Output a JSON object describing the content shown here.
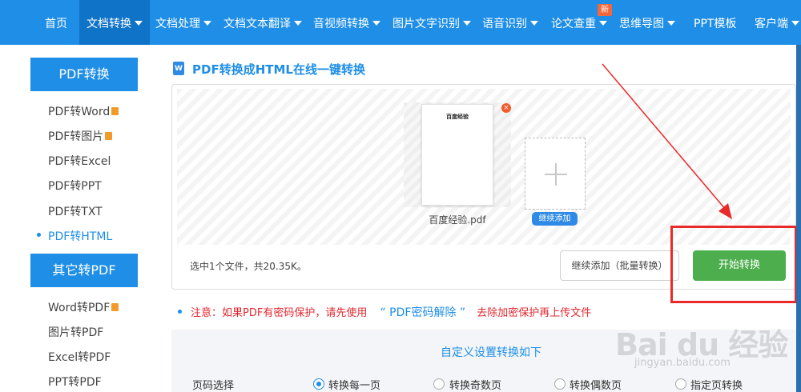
{
  "topnav": {
    "items": [
      {
        "label": "首页",
        "dropdown": false
      },
      {
        "label": "文档转换",
        "dropdown": true,
        "active": true
      },
      {
        "label": "文档处理",
        "dropdown": true
      },
      {
        "label": "文档文本翻译",
        "dropdown": true
      },
      {
        "label": "音视频转换",
        "dropdown": true
      },
      {
        "label": "图片文字识别",
        "dropdown": true
      },
      {
        "label": "语音识别",
        "dropdown": true
      },
      {
        "label": "论文查重",
        "dropdown": true
      },
      {
        "label": "思维导图",
        "dropdown": true
      },
      {
        "label": "PPT模板",
        "dropdown": false
      },
      {
        "label": "客户端",
        "dropdown": true
      }
    ],
    "new_badge": "新",
    "colors": {
      "bar": "#1e8ee6",
      "active": "#0f73c8",
      "badge": "#f5663a"
    }
  },
  "sidebar": {
    "group1_title": "PDF转换",
    "group1_items": [
      "PDF转Word",
      "PDF转图片",
      "PDF转Excel",
      "PDF转PPT",
      "PDF转TXT",
      "PDF转HTML"
    ],
    "group2_title": "其它转PDF",
    "group2_items": [
      "Word转PDF",
      "图片转PDF",
      "Excel转PDF",
      "PPT转PDF"
    ],
    "active_item": "PDF转HTML"
  },
  "main": {
    "title_icon": "W",
    "title": "PDF转换成HTML在线一键转换",
    "file": {
      "name": "百度经验.pdf",
      "preview_text": "百度经验",
      "remove_icon": "×"
    },
    "add_pill": "继续添加",
    "summary": "选中1个文件，共20.35K。",
    "btn_batch": "继续添加（批量转换）",
    "btn_start": "开始转换",
    "notice_prefix": "注意：如果PDF有密码保护，请先使用",
    "notice_link": "“ PDF密码解除 ”",
    "notice_suffix": "去除加密保护再上传文件",
    "settings_title": "自定义设置转换如下",
    "page_label": "页码选择",
    "radios": [
      {
        "label": "转换每一页",
        "checked": true
      },
      {
        "label": "转换奇数页",
        "checked": false
      },
      {
        "label": "转换偶数页",
        "checked": false
      },
      {
        "label": "指定页转换",
        "checked": false
      }
    ]
  },
  "watermark": {
    "text": "Bai du 经验",
    "sub": "jingyan.baidu.com"
  },
  "colors": {
    "primary": "#1e8ee6",
    "start_green": "#4cae4c",
    "highlight_red": "#e82a2a",
    "notice_red": "#e0272f"
  }
}
